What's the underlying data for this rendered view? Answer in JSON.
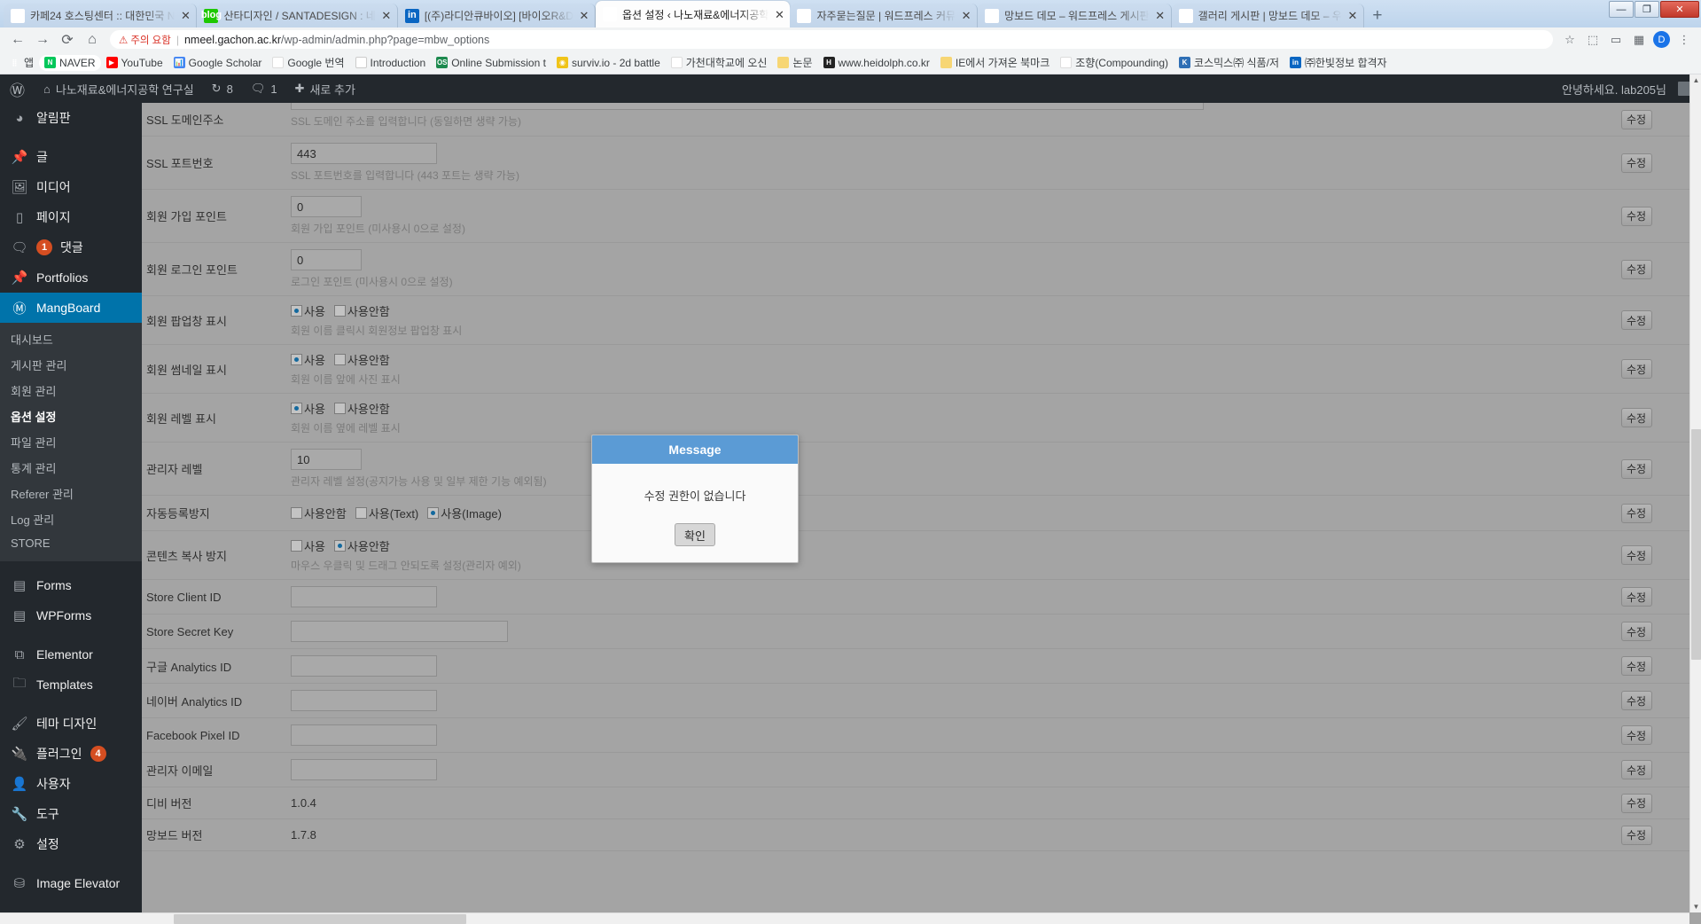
{
  "browser": {
    "tabs": [
      {
        "title": "카페24 호스팅센터 :: 대한민국 N",
        "icon": "cafe24-favicon",
        "active": false
      },
      {
        "title": "산타디자인 / SANTADESIGN : 네",
        "icon": "blog-favicon",
        "active": false
      },
      {
        "title": "[(주)라디안큐바이오] [바이오R&D",
        "icon": "linkedin-favicon",
        "active": false
      },
      {
        "title": "옵션 설정 ‹ 나노재료&에너지공학",
        "icon": "document-favicon",
        "active": true
      },
      {
        "title": "자주묻는질문 | 워드프레스 커뮤",
        "icon": "mangboard-favicon",
        "active": false
      },
      {
        "title": "망보드 데모 – 워드프레스 게시판",
        "icon": "mangboard-favicon",
        "active": false
      },
      {
        "title": "갤러리 게시판 | 망보드 데모 – 우",
        "icon": "mangboard-favicon",
        "active": false
      }
    ],
    "new_tab_label": "+",
    "window_controls": {
      "minimize": "—",
      "maximize": "❐",
      "close": "✕"
    },
    "nav": {
      "back": "←",
      "forward": "→",
      "reload": "⟳",
      "home": "⌂"
    },
    "omnibox": {
      "security_warning": "주의 요함",
      "url_host": "nmeel.gachon.ac.kr",
      "url_path": "/wp-admin/admin.php?page=mbw_options"
    },
    "toolbar_icons": [
      "star-icon",
      "extension-icon",
      "cast-icon",
      "app-icon",
      "profile-avatar",
      "menu-icon"
    ],
    "profile_initial": "D",
    "bookmarks": [
      {
        "label": "앱",
        "icon": "apps-grid-icon"
      },
      {
        "label": "NAVER",
        "icon": "naver-icon"
      },
      {
        "label": "YouTube",
        "icon": "youtube-icon"
      },
      {
        "label": "Google Scholar",
        "icon": "scholar-icon"
      },
      {
        "label": "Google 번역",
        "icon": "google-translate-icon"
      },
      {
        "label": "Introduction",
        "icon": "document-icon"
      },
      {
        "label": "Online Submission t",
        "icon": "online-submission-icon"
      },
      {
        "label": "surviv.io - 2d battle",
        "icon": "surviv-icon"
      },
      {
        "label": "가천대학교에 오신",
        "icon": "gachon-icon"
      },
      {
        "label": "논문",
        "icon": "folder-icon"
      },
      {
        "label": "www.heidolph.co.kr",
        "icon": "heidolph-icon"
      },
      {
        "label": "IE에서 가져온 북마크",
        "icon": "folder-icon"
      },
      {
        "label": "조향(Compounding)",
        "icon": "compounding-icon"
      },
      {
        "label": "코스믹스㈜ 식품/저",
        "icon": "cosmics-icon"
      },
      {
        "label": "㈜한빛정보 합격자",
        "icon": "hanbit-icon"
      }
    ]
  },
  "adminbar": {
    "logo": "wordpress-icon",
    "site_icon": "home-icon",
    "site_name": "나노재료&에너지공학 연구실",
    "updates_icon": "updates-icon",
    "updates_count": "8",
    "comments_icon": "comment-icon",
    "comments_count": "1",
    "new_icon": "plus-icon",
    "new_label": "새로 추가",
    "howdy": "안녕하세요. lab205님",
    "avatar": "user-avatar"
  },
  "sidebar": {
    "items": [
      {
        "label": "알림판",
        "icon": "dashboard-icon",
        "badge": null,
        "current": false
      },
      {
        "label": "글",
        "icon": "pin-icon",
        "badge": null,
        "current": false,
        "sep_before": true
      },
      {
        "label": "미디어",
        "icon": "media-icon",
        "badge": null,
        "current": false
      },
      {
        "label": "페이지",
        "icon": "page-icon",
        "badge": null,
        "current": false
      },
      {
        "label": "댓글",
        "icon": "comment-icon",
        "badge": "1",
        "current": false
      },
      {
        "label": "Portfolios",
        "icon": "pin-icon",
        "badge": null,
        "current": false
      },
      {
        "label": "MangBoard",
        "icon": "mangboard-icon",
        "badge": null,
        "current": true
      }
    ],
    "submenu": [
      {
        "label": "대시보드",
        "active": false
      },
      {
        "label": "게시판 관리",
        "active": false
      },
      {
        "label": "회원 관리",
        "active": false
      },
      {
        "label": "옵션 설정",
        "active": true
      },
      {
        "label": "파일 관리",
        "active": false
      },
      {
        "label": "통계 관리",
        "active": false
      },
      {
        "label": "Referer 관리",
        "active": false
      },
      {
        "label": "Log 관리",
        "active": false
      },
      {
        "label": "STORE",
        "active": false
      }
    ],
    "items2": [
      {
        "label": "Forms",
        "icon": "forms-icon",
        "badge": null,
        "sep_before": true
      },
      {
        "label": "WPForms",
        "icon": "wpforms-icon",
        "badge": null
      },
      {
        "label": "Elementor",
        "icon": "elementor-icon",
        "badge": null,
        "sep_before": true
      },
      {
        "label": "Templates",
        "icon": "folder-icon",
        "badge": null
      },
      {
        "label": "테마 디자인",
        "icon": "brush-icon",
        "badge": null,
        "sep_before": true
      },
      {
        "label": "플러그인",
        "icon": "plugin-icon",
        "badge": "4"
      },
      {
        "label": "사용자",
        "icon": "user-icon",
        "badge": null
      },
      {
        "label": "도구",
        "icon": "tools-icon",
        "badge": null
      },
      {
        "label": "설정",
        "icon": "settings-icon",
        "badge": null
      },
      {
        "label": "Image Elevator",
        "icon": "image-elevator-icon",
        "badge": null,
        "sep_before": true
      }
    ]
  },
  "options": {
    "edit_button_label": "수정",
    "rows": [
      {
        "label": "SSL 도메인주소",
        "type": "text",
        "value": "",
        "width": "w1030",
        "desc": "SSL 도메인 주소를 입력합니다 (동일하면 생략 가능)",
        "clipped_top": true
      },
      {
        "label": "SSL 포트번호",
        "type": "text",
        "value": "443",
        "width": "w165",
        "desc": "SSL 포트번호를 입력합니다 (443 포트는 생략 가능)"
      },
      {
        "label": "회원 가입 포인트",
        "type": "text",
        "value": "0",
        "width": "w80",
        "desc": "회원 가입 포인트 (미사용시 0으로 설정)"
      },
      {
        "label": "회원 로그인 포인트",
        "type": "text",
        "value": "0",
        "width": "w80",
        "desc": "로그인 포인트 (미사용시 0으로 설정)"
      },
      {
        "label": "회원 팝업창 표시",
        "type": "radio",
        "choices": [
          {
            "label": "사용",
            "checked": true
          },
          {
            "label": "사용안함",
            "checked": false
          }
        ],
        "desc": "회원 이름 클릭시 회원정보 팝업창 표시"
      },
      {
        "label": "회원 썸네일 표시",
        "type": "radio",
        "choices": [
          {
            "label": "사용",
            "checked": true
          },
          {
            "label": "사용안함",
            "checked": false
          }
        ],
        "desc": "회원 이름 앞에 사진 표시"
      },
      {
        "label": "회원 레벨 표시",
        "type": "radio",
        "choices": [
          {
            "label": "사용",
            "checked": true
          },
          {
            "label": "사용안함",
            "checked": false
          }
        ],
        "desc": "회원 이름 옆에 레벨 표시"
      },
      {
        "label": "관리자 레벨",
        "type": "text",
        "value": "10",
        "width": "w80",
        "desc": "관리자 레벨 설정(공지가능 사용 및 일부 제한 기능 예외됨)"
      },
      {
        "label": "자동등록방지",
        "type": "radio",
        "choices": [
          {
            "label": "사용안함",
            "checked": false
          },
          {
            "label": "사용(Text)",
            "checked": false
          },
          {
            "label": "사용(Image)",
            "checked": true
          }
        ],
        "desc": ""
      },
      {
        "label": "콘텐츠 복사 방지",
        "type": "radio",
        "choices": [
          {
            "label": "사용",
            "checked": false
          },
          {
            "label": "사용안함",
            "checked": true
          }
        ],
        "desc": "마우스 우클릭 및 드래그 안되도록 설정(관리자 예외)"
      },
      {
        "label": "Store Client ID",
        "type": "text",
        "value": "",
        "width": "w165",
        "desc": ""
      },
      {
        "label": "Store Secret Key",
        "type": "text",
        "value": "",
        "width": "w245",
        "desc": ""
      },
      {
        "label": "구글 Analytics ID",
        "type": "text",
        "value": "",
        "width": "w165",
        "desc": ""
      },
      {
        "label": "네이버 Analytics ID",
        "type": "text",
        "value": "",
        "width": "w165",
        "desc": ""
      },
      {
        "label": "Facebook Pixel ID",
        "type": "text",
        "value": "",
        "width": "w165",
        "desc": ""
      },
      {
        "label": "관리자 이메일",
        "type": "text",
        "value": "",
        "width": "w165",
        "desc": ""
      },
      {
        "label": "디비 버전",
        "type": "static",
        "value": "1.0.4",
        "desc": ""
      },
      {
        "label": "망보드 버전",
        "type": "static",
        "value": "1.7.8",
        "desc": ""
      }
    ]
  },
  "modal": {
    "title": "Message",
    "message": "수정 권한이 없습니다",
    "confirm_label": "확인",
    "header_color": "#5b9bd5"
  }
}
